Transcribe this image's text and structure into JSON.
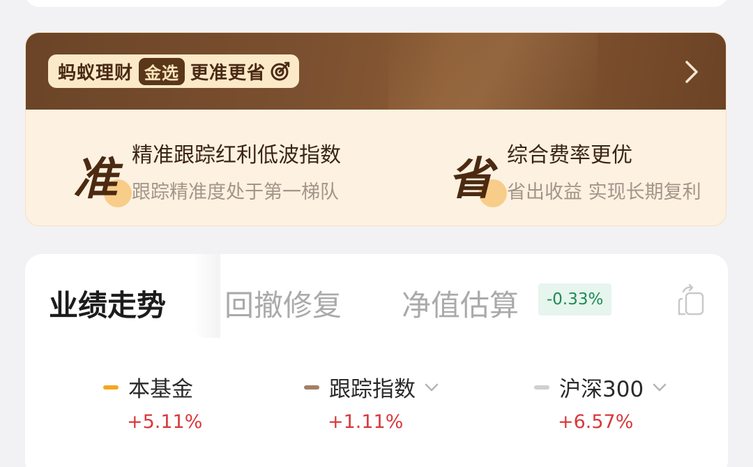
{
  "banner": {
    "brand_name": "蚂蚁理财",
    "brand_tag": "金选",
    "slogan": "更准更省",
    "arrow_icon": "chevron-right-icon",
    "features": [
      {
        "char": "准",
        "title": "精准跟踪红利低波指数",
        "subtitle": "跟踪精准度处于第一梯队"
      },
      {
        "char": "省",
        "title": "综合费率更优",
        "subtitle": "省出收益 实现长期复利"
      }
    ]
  },
  "tabs": [
    {
      "label": "业绩走势",
      "active": true
    },
    {
      "label": "回撤修复",
      "active": false
    },
    {
      "label": "净值估算",
      "active": false
    }
  ],
  "nav_change_badge": "-0.33%",
  "legend": [
    {
      "label": "本基金",
      "value": "+5.11%",
      "color": "#f5a623",
      "has_dropdown": false
    },
    {
      "label": "跟踪指数",
      "value": "+1.11%",
      "color": "#a37f64",
      "has_dropdown": true
    },
    {
      "label": "沪深300",
      "value": "+6.57%",
      "color": "#cfcfcf",
      "has_dropdown": true
    }
  ],
  "colors": {
    "banner_dark": "#6b4427",
    "banner_light": "#fdf1e1",
    "positive_red": "#d9383a",
    "badge_green": "#1f8a53"
  }
}
